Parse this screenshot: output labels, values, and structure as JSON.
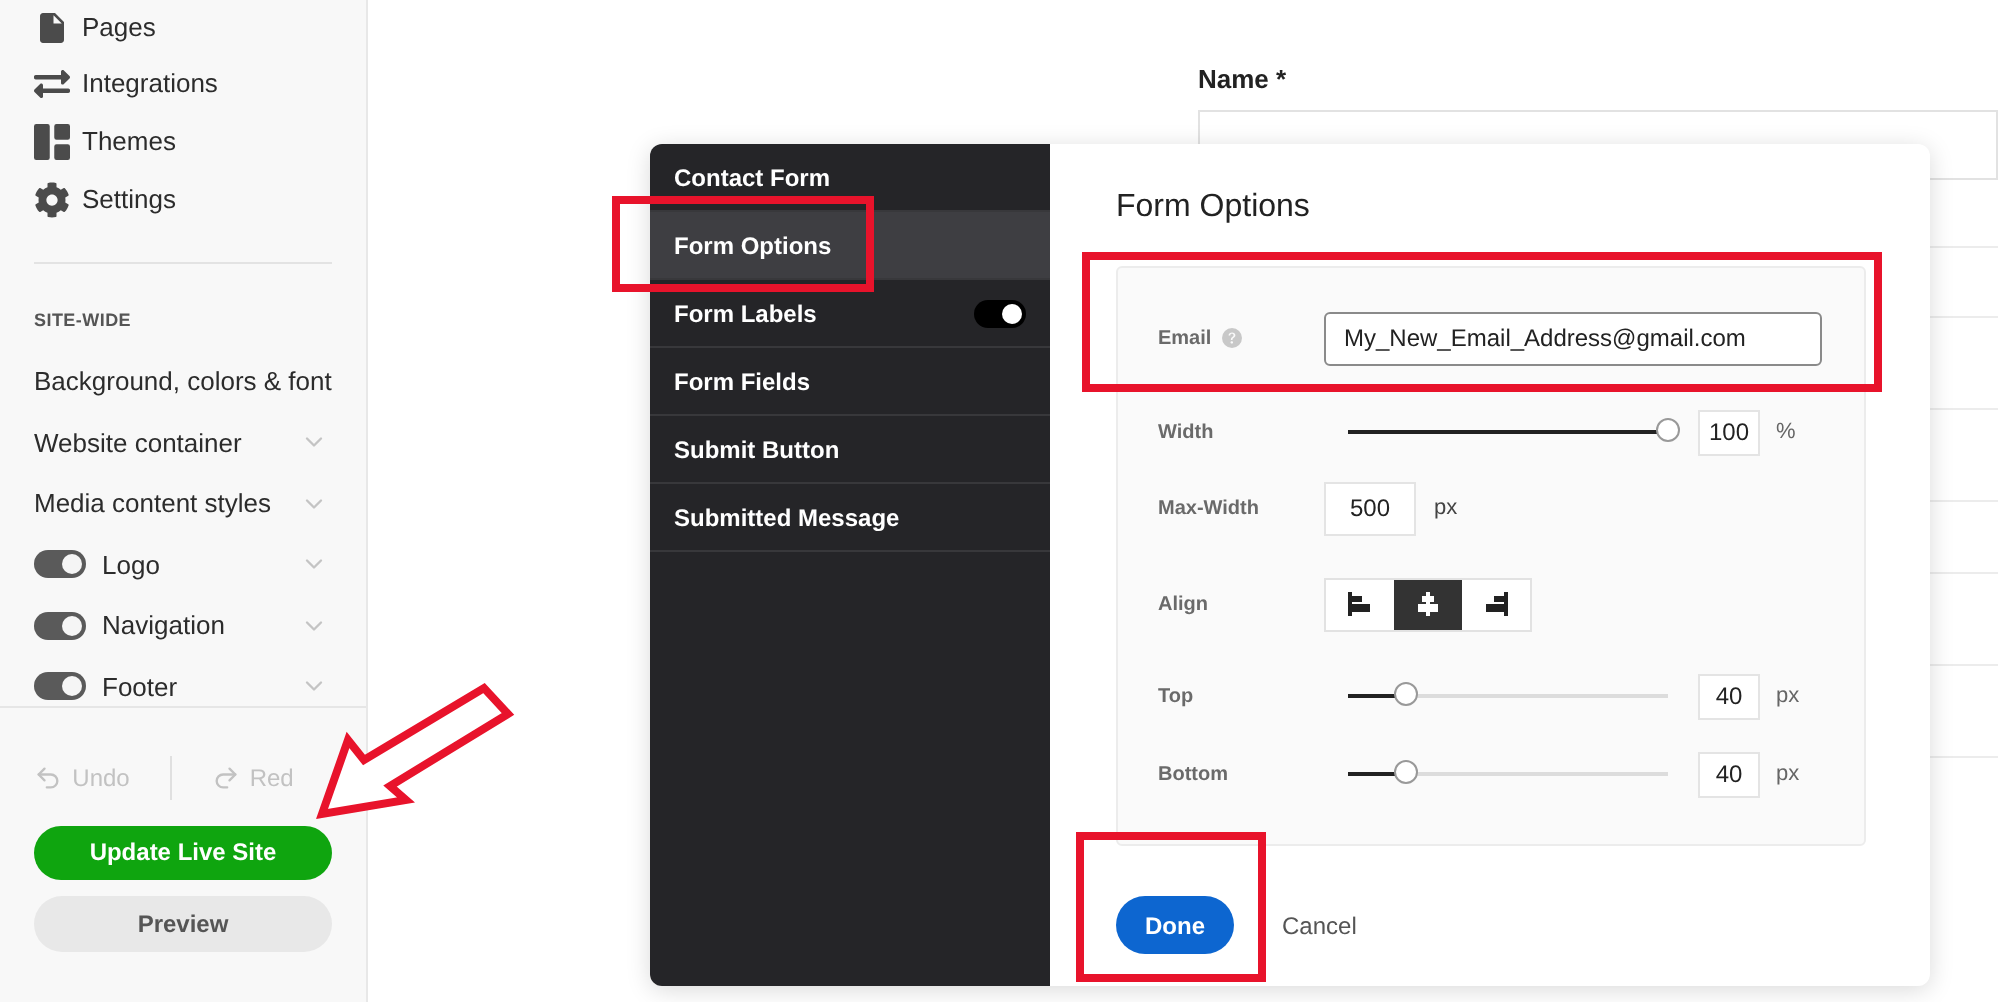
{
  "sidebar": {
    "nav": [
      {
        "label": "Pages"
      },
      {
        "label": "Integrations"
      },
      {
        "label": "Themes"
      },
      {
        "label": "Settings"
      }
    ],
    "section_title": "SITE-WIDE",
    "items": [
      {
        "label": "Background, colors & font",
        "kind": "plain"
      },
      {
        "label": "Website container",
        "kind": "expandable"
      },
      {
        "label": "Media content styles",
        "kind": "expandable"
      },
      {
        "label": "Logo",
        "kind": "toggle",
        "on": true
      },
      {
        "label": "Navigation",
        "kind": "toggle",
        "on": true
      },
      {
        "label": "Footer",
        "kind": "toggle",
        "on": true
      }
    ],
    "history": [
      {
        "label": "Undo",
        "kind": "undo",
        "disabled": true
      },
      {
        "label": "Red",
        "kind": "redo",
        "disabled": true
      }
    ],
    "primary_button": "Update Live Site",
    "secondary_button": "Preview"
  },
  "page_form": {
    "label": "Name *"
  },
  "dialog": {
    "menu": [
      {
        "label": "Contact Form",
        "selected": false
      },
      {
        "label": "Form Options",
        "selected": true
      },
      {
        "label": "Form Labels",
        "selected": false,
        "toggle": true
      },
      {
        "label": "Form Fields",
        "selected": false
      },
      {
        "label": "Submit Button",
        "selected": false
      },
      {
        "label": "Submitted Message",
        "selected": false
      }
    ],
    "title": "Form Options",
    "fields": [
      {
        "kind": "text",
        "label": "Email",
        "value": "My_New_Email_Address@gmail.com"
      },
      {
        "kind": "slider",
        "label": "Width",
        "level": 1,
        "value": "100",
        "unit": "%"
      },
      {
        "kind": "number",
        "label": "Max-Width",
        "value": "500",
        "unit": "px"
      },
      {
        "kind": "align",
        "label": "Align",
        "options": [
          {
            "kind": "left",
            "selected": false
          },
          {
            "kind": "center",
            "selected": true
          },
          {
            "kind": "right",
            "selected": false
          }
        ]
      },
      {
        "kind": "slider",
        "label": "Top",
        "level": 0.18,
        "value": "40",
        "unit": "px"
      },
      {
        "kind": "slider",
        "label": "Bottom",
        "level": 0.18,
        "value": "40",
        "unit": "px"
      }
    ],
    "done": "Done",
    "cancel": "Cancel"
  }
}
